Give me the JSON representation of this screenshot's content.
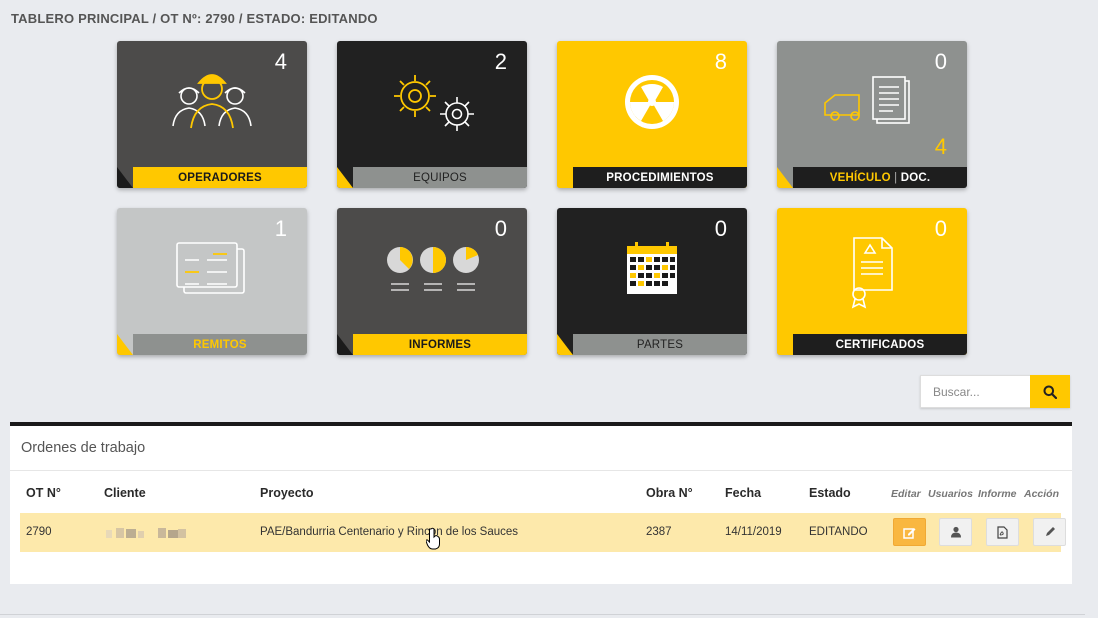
{
  "breadcrumb": "TABLERO PRINCIPAL / OT Nº: 2790 / ESTADO: EDITANDO",
  "tiles": [
    {
      "label": "OPERADORES",
      "count": "4",
      "icon": "workers-icon"
    },
    {
      "label": "EQUIPOS",
      "count": "2",
      "icon": "gears-icon"
    },
    {
      "label": "PROCEDIMIENTOS",
      "count": "8",
      "icon": "radiation-icon"
    },
    {
      "label_a": "VEHÍCULO",
      "label_sep": " | ",
      "label_b": "DOC.",
      "count": "0",
      "count2": "4",
      "icon": "vehicle-document-icon"
    },
    {
      "label": "REMITOS",
      "count": "1",
      "icon": "receipts-icon"
    },
    {
      "label": "INFORMES",
      "count": "0",
      "icon": "pie-reports-icon"
    },
    {
      "label": "PARTES",
      "count": "0",
      "icon": "calendar-icon"
    },
    {
      "label": "CERTIFICADOS",
      "count": "0",
      "icon": "certificate-icon"
    }
  ],
  "search": {
    "placeholder": "Buscar..."
  },
  "panel": {
    "title": "Ordenes de trabajo",
    "headers": {
      "ot": "OT N°",
      "cliente": "Cliente",
      "proyecto": "Proyecto",
      "obra": "Obra N°",
      "fecha": "Fecha",
      "estado": "Estado"
    },
    "action_headers": {
      "editar": "Editar",
      "usuarios": "Usuarios",
      "informe": "Informe",
      "accion": "Acción"
    },
    "rows": [
      {
        "ot": "2790",
        "proyecto": "PAE/Bandurria Centenario y Rincon de los Sauces",
        "obra": "2387",
        "fecha": "14/11/2019",
        "estado": "EDITANDO"
      }
    ]
  },
  "colors": {
    "accent": "#ffc800",
    "dark": "#212121"
  }
}
